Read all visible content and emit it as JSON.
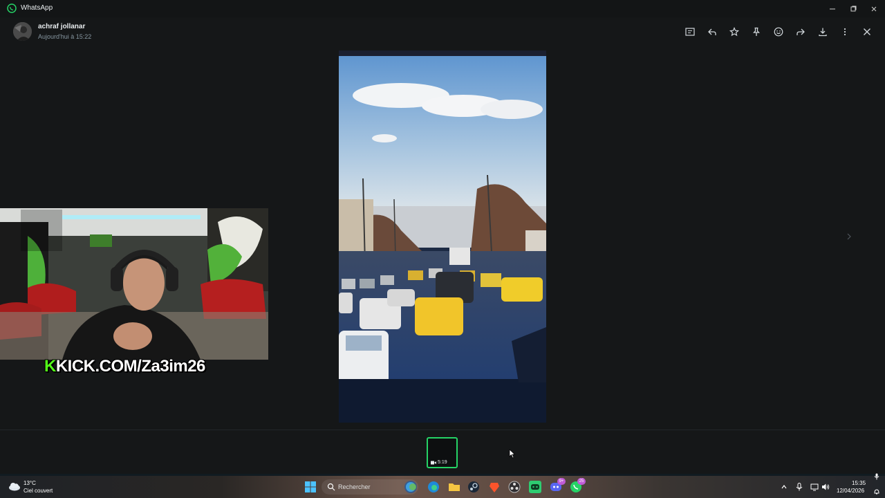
{
  "window": {
    "title": "WhatsApp"
  },
  "message": {
    "sender": "achraf jollanar",
    "timestamp": "Aujourd'hui à 15:22"
  },
  "actions": [
    "message-icon",
    "reply-icon",
    "star-icon",
    "pin-icon",
    "emoji-icon",
    "forward-icon",
    "download-icon",
    "more-icon",
    "close-icon"
  ],
  "overlay": {
    "brand_letter": "K",
    "text": "KICK.COM/Za3im26"
  },
  "thumbnail": {
    "duration": "5:19"
  },
  "taskbar": {
    "weather_temp": "13°C",
    "weather_desc": "Ciel couvert",
    "search_placeholder": "Rechercher",
    "whatsapp_badge": "25",
    "discord_badge": "9+",
    "time": "15:35",
    "date": "12/04/2026"
  },
  "colors": {
    "accent": "#25d366",
    "kick_green": "#53fc18"
  }
}
